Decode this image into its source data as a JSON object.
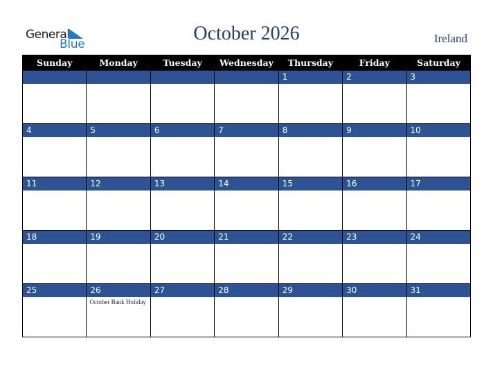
{
  "logo": {
    "word1": "General",
    "word2": "Blue"
  },
  "title": "October 2026",
  "country": "Ireland",
  "weekdays": [
    "Sunday",
    "Monday",
    "Tuesday",
    "Wednesday",
    "Thursday",
    "Friday",
    "Saturday"
  ],
  "weeks": [
    [
      {
        "day": ""
      },
      {
        "day": ""
      },
      {
        "day": ""
      },
      {
        "day": ""
      },
      {
        "day": "1"
      },
      {
        "day": "2"
      },
      {
        "day": "3"
      }
    ],
    [
      {
        "day": "4"
      },
      {
        "day": "5"
      },
      {
        "day": "6"
      },
      {
        "day": "7"
      },
      {
        "day": "8"
      },
      {
        "day": "9"
      },
      {
        "day": "10"
      }
    ],
    [
      {
        "day": "11"
      },
      {
        "day": "12"
      },
      {
        "day": "13"
      },
      {
        "day": "14"
      },
      {
        "day": "15"
      },
      {
        "day": "16"
      },
      {
        "day": "17"
      }
    ],
    [
      {
        "day": "18"
      },
      {
        "day": "19"
      },
      {
        "day": "20"
      },
      {
        "day": "21"
      },
      {
        "day": "22"
      },
      {
        "day": "23"
      },
      {
        "day": "24"
      }
    ],
    [
      {
        "day": "25"
      },
      {
        "day": "26",
        "event": "October Bank Holiday"
      },
      {
        "day": "27"
      },
      {
        "day": "28"
      },
      {
        "day": "29"
      },
      {
        "day": "30"
      },
      {
        "day": "31"
      }
    ]
  ]
}
